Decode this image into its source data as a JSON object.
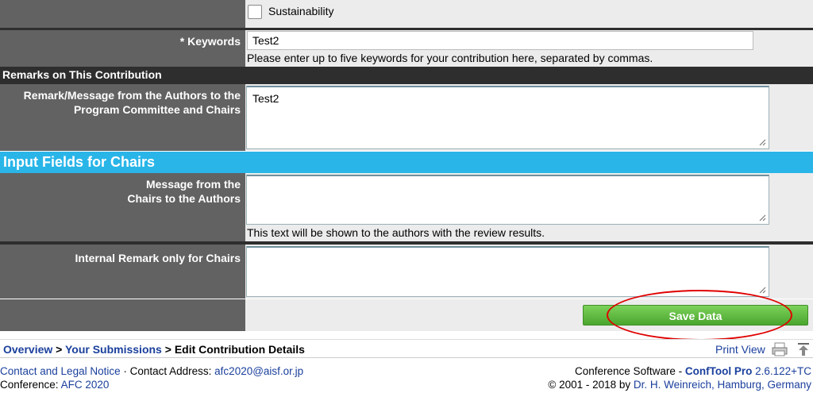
{
  "form": {
    "sustainability_label": "Sustainability",
    "keywords_label": "* Keywords",
    "keywords_value": "Test2",
    "keywords_hint": "Please enter up to five keywords for your contribution here, separated by commas.",
    "remarks_section": "Remarks on This Contribution",
    "remark_label": "Remark/Message from the Authors to the Program Committee and Chairs",
    "remark_value": "Test2",
    "chairs_section": "Input Fields for Chairs",
    "chairs_message_label": "Message from the Chairs to the Authors",
    "chairs_message_hint": "This text will be shown to the authors with the review results.",
    "internal_remark_label": "Internal Remark only for Chairs",
    "save_button": "Save Data"
  },
  "breadcrumb": {
    "overview": "Overview",
    "sep1": " > ",
    "submissions": "Your Submissions",
    "sep2": " > ",
    "current": "Edit Contribution Details"
  },
  "print_view": "Print View",
  "footer": {
    "contact_link": "Contact and Legal Notice",
    "contact_address_label": " · Contact Address: ",
    "email": "afc2020@aisf.or.jp",
    "conference_label": "Conference: ",
    "conference_name": "AFC 2020",
    "software_label": "Conference Software - ",
    "software_name": "ConfTool Pro",
    "software_version": " 2.6.122+TC",
    "copyright": "© 2001 - 2018 by ",
    "author": "Dr. H. Weinreich, Hamburg, Germany"
  },
  "colors": {
    "label_bg": "#626262",
    "section_dark": "#2e2e2e",
    "section_blue": "#29b5e8",
    "save_green": "#5cb83c",
    "highlight_red": "#e00000"
  }
}
